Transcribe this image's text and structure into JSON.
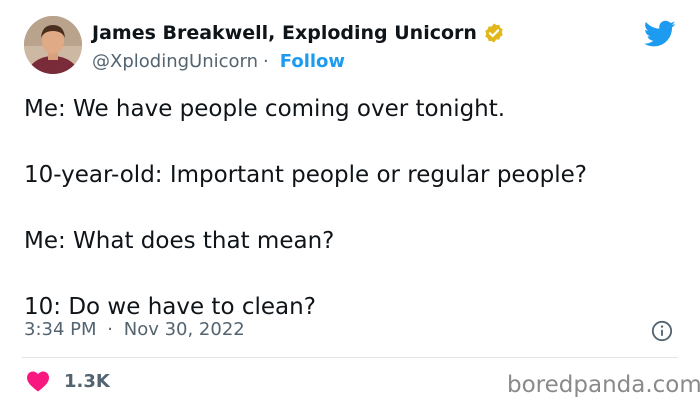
{
  "author": {
    "display_name": "James Breakwell, Exploding Unicorn",
    "handle": "@XplodingUnicorn",
    "separator": "·",
    "follow_label": "Follow",
    "avatar_icon": "avatar-photo",
    "verified_icon": "verified-badge-icon"
  },
  "tweet": {
    "lines": [
      "Me: We have people coming over tonight.",
      "10-year-old: Important people or regular people?",
      "Me: What does that mean?",
      "10: Do we have to clean?"
    ],
    "time": "3:34 PM",
    "separator": "·",
    "date": "Nov 30, 2022"
  },
  "engagement": {
    "likes": "1.3K",
    "like_icon": "heart-icon",
    "info_icon": "info-icon"
  },
  "branding": {
    "platform_icon": "twitter-bird-icon",
    "watermark": "boredpanda.com"
  },
  "colors": {
    "accent_blue": "#1d9bf0",
    "verified_gold": "#e2b719",
    "heart_pink": "#f91880",
    "secondary_text": "#536471",
    "primary_text": "#0f1419"
  }
}
